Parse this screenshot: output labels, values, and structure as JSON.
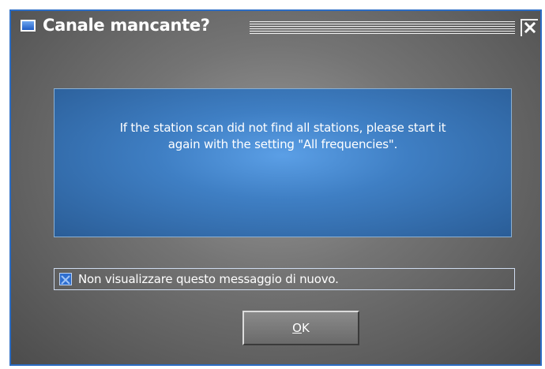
{
  "window": {
    "title": "Canale mancante?",
    "icon": "window-icon",
    "close_icon": "close-icon"
  },
  "message": {
    "line1": "If the station scan did not find all stations, please start it",
    "line2": "again with the setting \"All frequencies\"."
  },
  "option": {
    "label": "Non visualizzare questo messaggio di nuovo.",
    "checked": true
  },
  "buttons": {
    "ok_mnemonic": "O",
    "ok_rest": "K"
  },
  "colors": {
    "accent": "#2b6cc4",
    "panel": "#3f7fc4",
    "background": "#747474"
  }
}
